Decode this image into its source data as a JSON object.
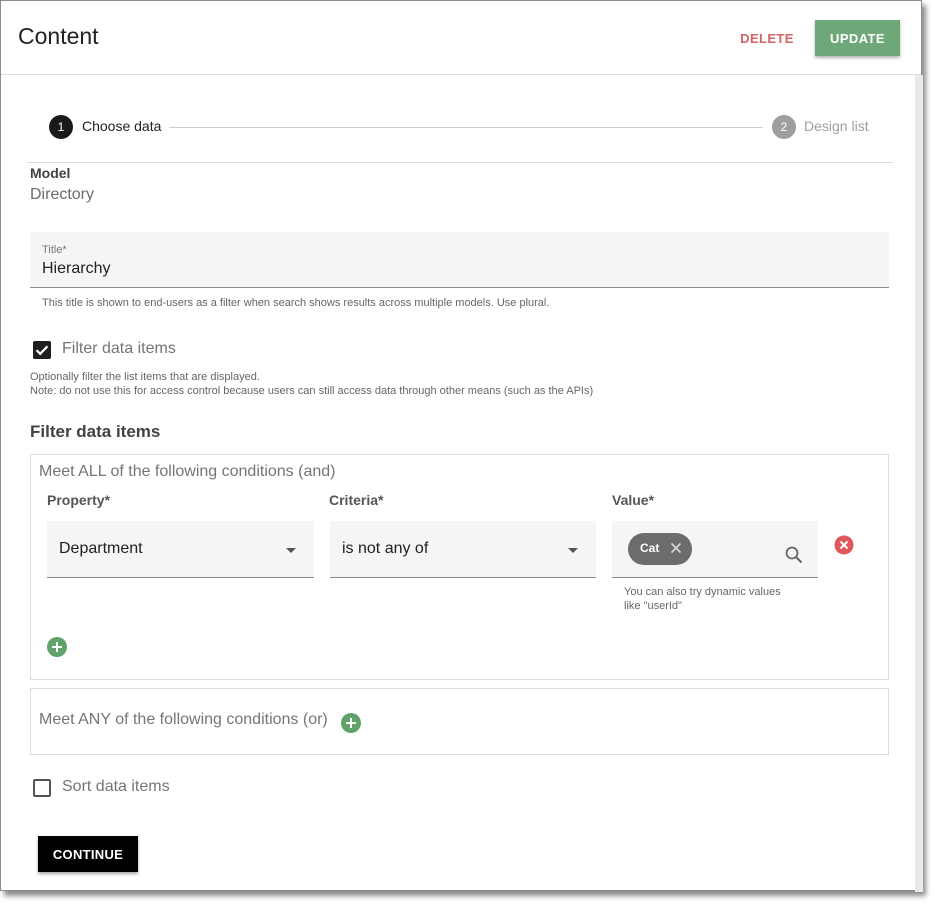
{
  "header": {
    "title": "Content",
    "delete_label": "DELETE",
    "update_label": "UPDATE",
    "update_color": "#6fa878",
    "delete_color": "#d36464"
  },
  "stepper": {
    "steps": [
      {
        "number": "1",
        "label": "Choose data",
        "active": true
      },
      {
        "number": "2",
        "label": "Design list",
        "active": false
      }
    ]
  },
  "model": {
    "label": "Model",
    "value": "Directory"
  },
  "title_field": {
    "label": "Title*",
    "value": "Hierarchy",
    "hint": "This title is shown to end-users as a filter when search shows results across multiple models. Use plural."
  },
  "filter_checkbox": {
    "label": "Filter data items",
    "checked": true,
    "hint_line1": "Optionally filter the list items that are displayed.",
    "hint_line2": "Note: do not use this for access control because users can still access data through other means (such as the APIs)"
  },
  "filter_section": {
    "title": "Filter data items",
    "all_group": {
      "title": "Meet ALL of the following conditions (and)",
      "columns": {
        "property": "Property*",
        "criteria": "Criteria*",
        "value": "Value*"
      },
      "conditions": [
        {
          "property": "Department",
          "criteria": "is not any of",
          "values": [
            "Cat"
          ],
          "value_hint_line1": "You can also try dynamic values",
          "value_hint_line2": "like \"userId\""
        }
      ]
    },
    "any_group": {
      "title": "Meet ANY of the following conditions (or)"
    }
  },
  "sort_checkbox": {
    "label": "Sort data items",
    "checked": false
  },
  "footer": {
    "continue_label": "CONTINUE"
  }
}
